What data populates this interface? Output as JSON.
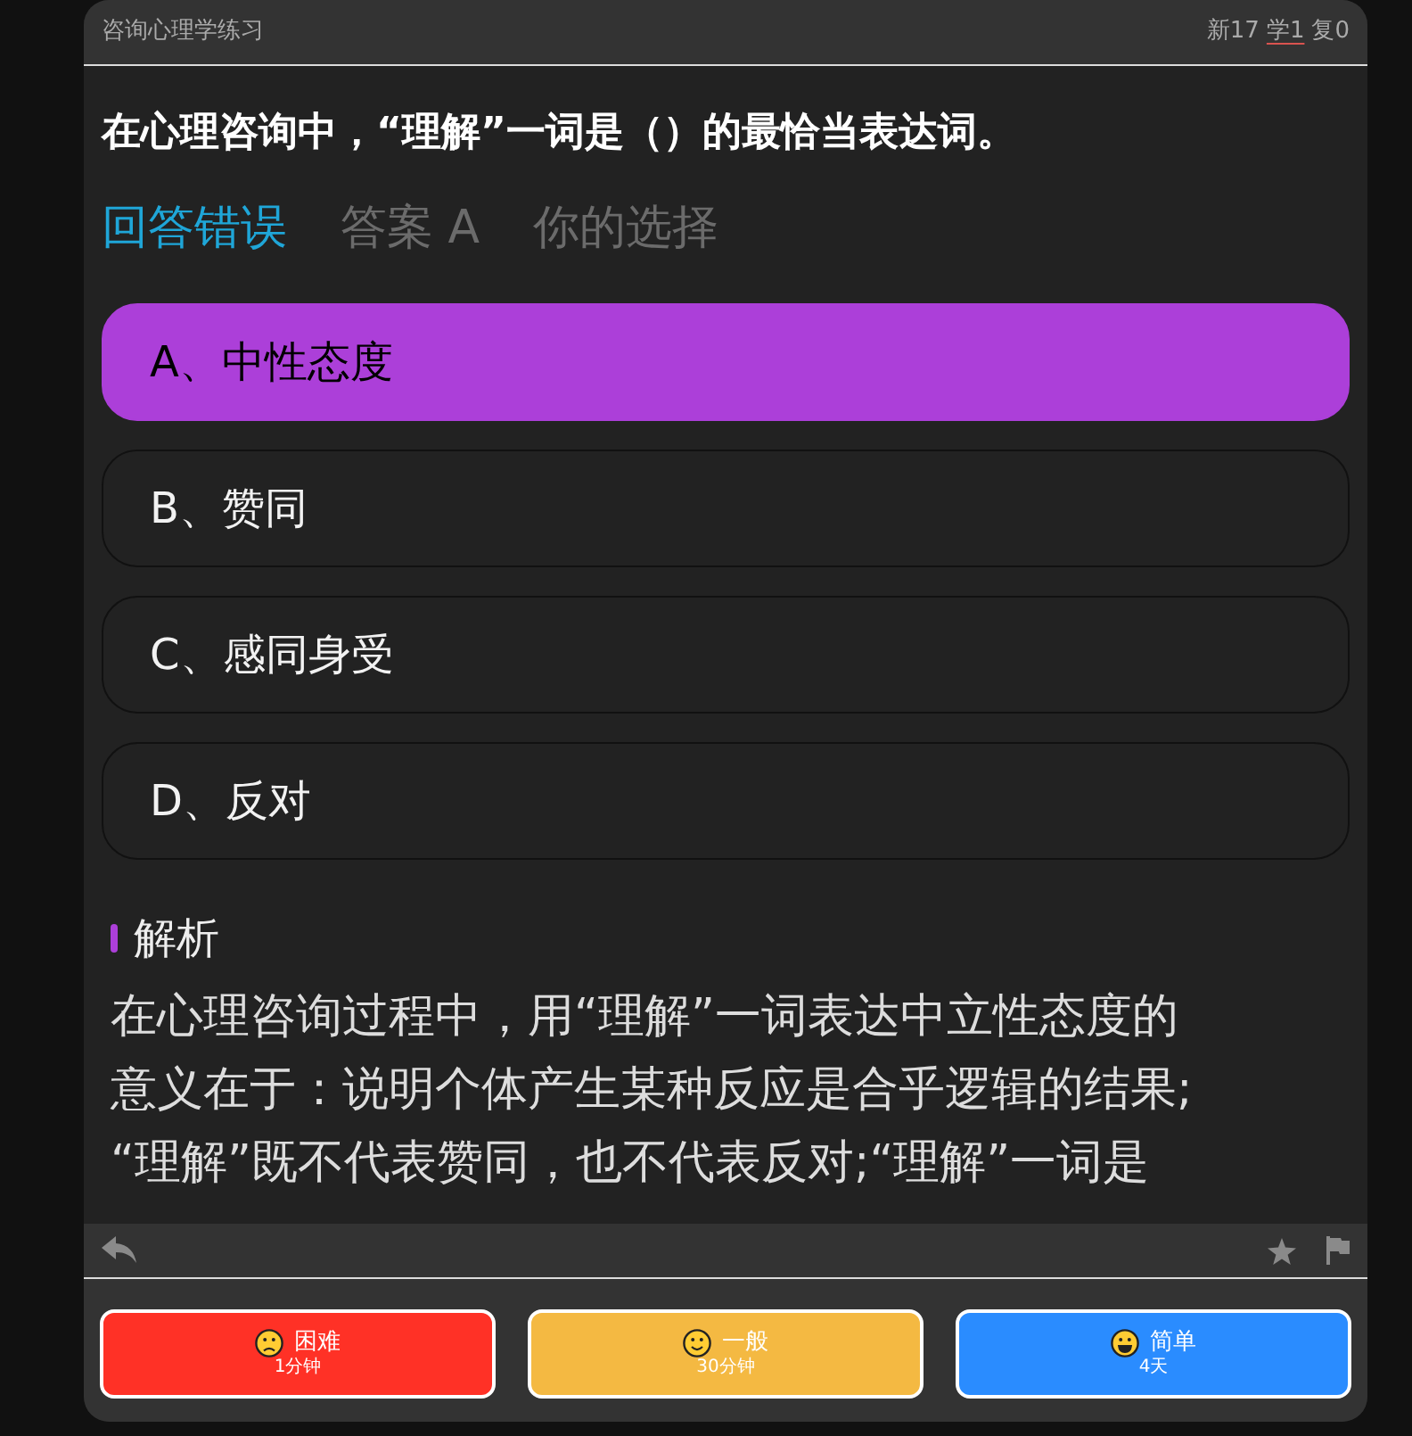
{
  "header": {
    "title": "咨询心理学练习",
    "counters": [
      {
        "label": "新17",
        "current": false
      },
      {
        "label": "学1",
        "current": true
      },
      {
        "label": "复0",
        "current": false
      }
    ]
  },
  "question": "在心理咨询中，“理解”一词是（）的最恰当表达词。",
  "result": {
    "verdict": "回答错误",
    "answer": "答案 A",
    "note": "你的选择"
  },
  "options": [
    {
      "label": "A、中性态度",
      "selected": true
    },
    {
      "label": "B、赞同",
      "selected": false
    },
    {
      "label": "C、感同身受",
      "selected": false
    },
    {
      "label": "D、反对",
      "selected": false
    }
  ],
  "explanation": {
    "heading": "解析",
    "text": "在心理咨询过程中，用“理解”一词表达中立性态度的意义在于：说明个体产生某种反应是合乎逻辑的结果;“理解”既不代表赞同，也不代表反对;“理解”一词是"
  },
  "rating_buttons": [
    {
      "kind": "hard",
      "label": "困难",
      "interval": "1分钟"
    },
    {
      "kind": "normal",
      "label": "一般",
      "interval": "30分钟"
    },
    {
      "kind": "easy",
      "label": "简单",
      "interval": "4天"
    }
  ]
}
